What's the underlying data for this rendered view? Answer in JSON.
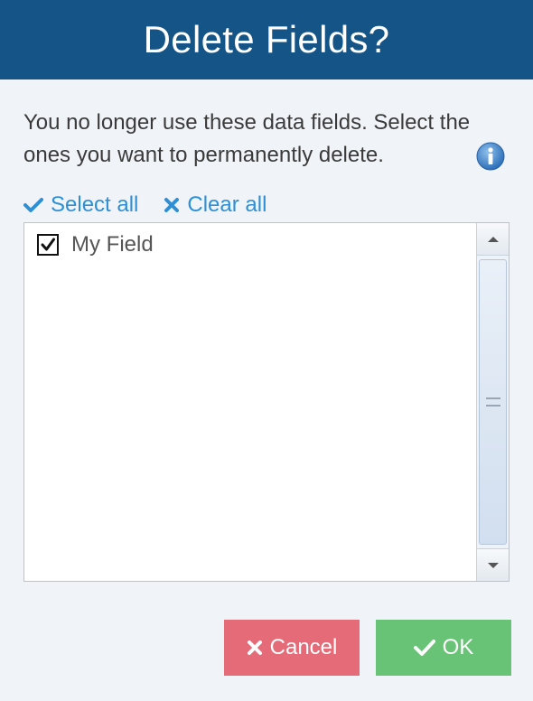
{
  "dialog": {
    "title": "Delete Fields?",
    "message": "You no longer use these data fields. Select the ones you want to permanently delete."
  },
  "selection": {
    "select_all_label": "Select all",
    "clear_all_label": "Clear all"
  },
  "fields": {
    "items": [
      {
        "label": "My Field",
        "checked": true
      }
    ]
  },
  "buttons": {
    "cancel_label": "Cancel",
    "ok_label": "OK"
  },
  "icons": {
    "info": "info-icon",
    "select_all": "checkmark-icon",
    "clear_all": "x-icon",
    "cancel": "x-icon",
    "ok": "checkmark-icon"
  },
  "colors": {
    "header_bg": "#155487",
    "link": "#2f8fd4",
    "cancel_bg": "#e56b78",
    "ok_bg": "#68c377"
  }
}
